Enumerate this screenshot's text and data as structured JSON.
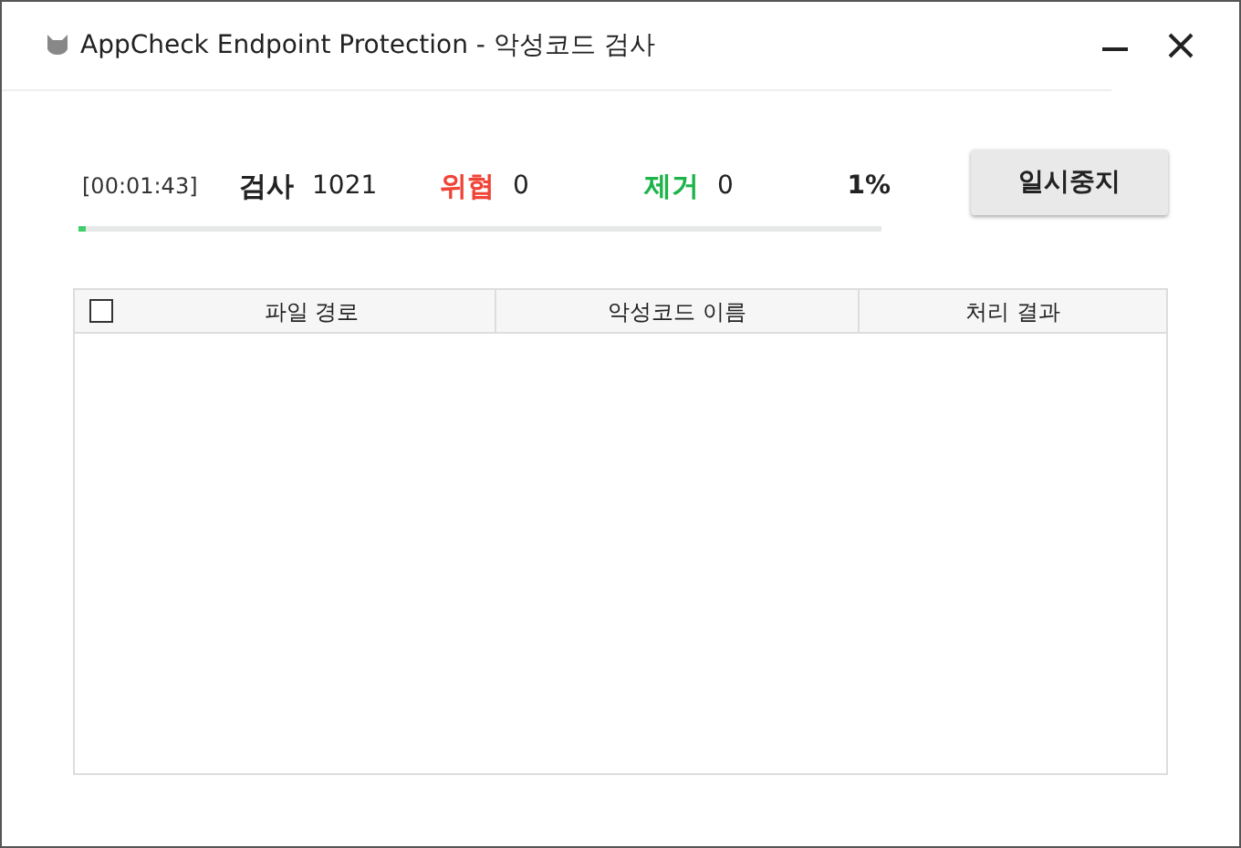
{
  "window": {
    "title": "AppCheck Endpoint Protection - 악성코드 검사"
  },
  "scan": {
    "elapsed": "[00:01:43]",
    "percent": "1%",
    "level": 0.01,
    "stats": [
      {
        "label": "검사",
        "value": "1021",
        "color": "#222222"
      },
      {
        "label": "위협",
        "value": "0",
        "color": "#f04438"
      },
      {
        "label": "제거",
        "value": "0",
        "color": "#1db34a"
      }
    ]
  },
  "pause_button": "일시중지",
  "table": {
    "select_all": {
      "checked": false
    },
    "columns": [
      "파일 경로",
      "악성코드 이름",
      "처리 결과"
    ]
  }
}
